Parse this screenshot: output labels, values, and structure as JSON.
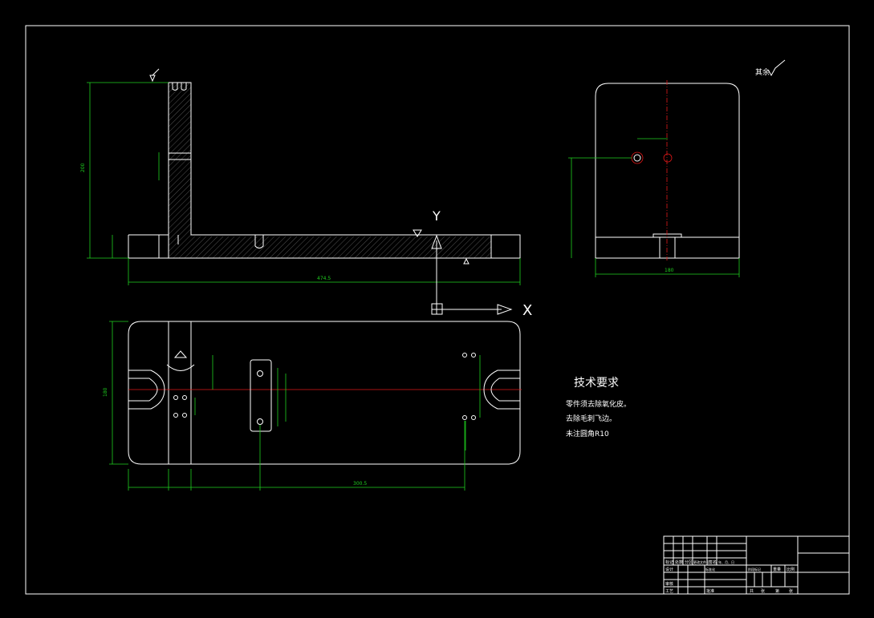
{
  "technical_requirements": {
    "title": "技术要求",
    "items": [
      "零件须去除氧化皮。",
      "去除毛刺飞边。",
      "未注圆角R10"
    ]
  },
  "surface_finish_note": "其余",
  "coordinate_axes": {
    "x_label": "X",
    "y_label": "Y"
  },
  "colors": {
    "background": "#000000",
    "outline": "#ffffff",
    "dimension": "#1fd01f",
    "centerline": "#e01818"
  },
  "title_block": {
    "cells": [
      "标记",
      "处数",
      "分区",
      "更改文件号",
      "签名",
      "年、月、日",
      "设计",
      "标准化",
      "阶段标记",
      "重量",
      "比例",
      "审核",
      "工艺",
      "批准",
      "共",
      "张",
      "第",
      "张"
    ]
  }
}
